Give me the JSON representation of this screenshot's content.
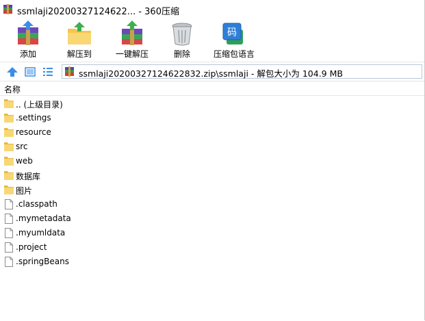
{
  "window": {
    "title": "ssmlaji20200327124622... - 360压缩",
    "icon": "winrar-archive-icon"
  },
  "toolbar": {
    "add_label": "添加",
    "extract_to_label": "解压到",
    "one_click_extract_label": "一键解压",
    "delete_label": "删除",
    "language_label": "压缩包语言",
    "language_icon_char": "码"
  },
  "addressbar": {
    "path": "ssmlaji20200327124622832.zip\\ssmlaji - 解包大小为 104.9 MB"
  },
  "list": {
    "column_name": "名称",
    "items": [
      {
        "name": ".. (上级目录)",
        "kind": "folder"
      },
      {
        "name": ".settings",
        "kind": "folder"
      },
      {
        "name": "resource",
        "kind": "folder"
      },
      {
        "name": "src",
        "kind": "folder"
      },
      {
        "name": "web",
        "kind": "folder"
      },
      {
        "name": "数据库",
        "kind": "folder"
      },
      {
        "name": "图片",
        "kind": "folder"
      },
      {
        "name": ".classpath",
        "kind": "file"
      },
      {
        "name": ".mymetadata",
        "kind": "file"
      },
      {
        "name": ".myumldata",
        "kind": "file"
      },
      {
        "name": ".project",
        "kind": "file"
      },
      {
        "name": ".springBeans",
        "kind": "file"
      }
    ]
  },
  "colors": {
    "folder": "#f8d775",
    "folder_dark": "#e6b93f",
    "accent_blue": "#3a8ee6"
  }
}
